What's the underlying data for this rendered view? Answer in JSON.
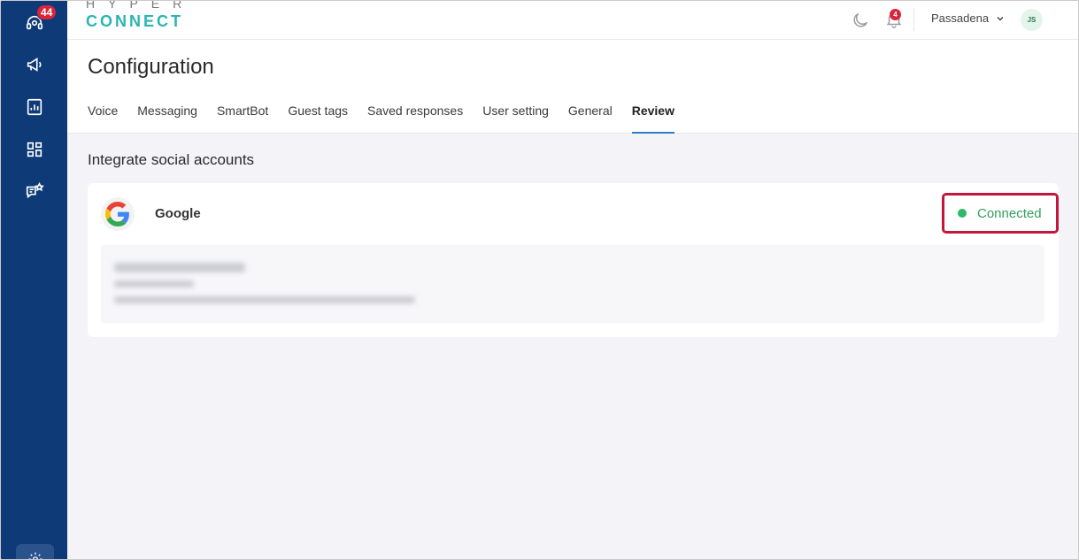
{
  "sidebar": {
    "badge_count": "44",
    "icons": [
      "headset-icon",
      "megaphone-icon",
      "report-icon",
      "apps-grid-icon",
      "chat-star-icon",
      "settings-icon"
    ]
  },
  "header": {
    "logo_top": "HYPER",
    "logo_bottom": "CONNECT",
    "notifications_count": "4",
    "location": "Passadena",
    "avatar_initials": "JS"
  },
  "page": {
    "title": "Configuration",
    "tabs": [
      "Voice",
      "Messaging",
      "SmartBot",
      "Guest tags",
      "Saved responses",
      "User setting",
      "General",
      "Review"
    ],
    "active_tab": "Review"
  },
  "integrations": {
    "section_title": "Integrate social accounts",
    "provider": "Google",
    "status": "Connected",
    "colors": {
      "status": "#2fb866",
      "highlight": "#c4163c",
      "sidebar": "#0e3a78",
      "accent": "#2f7cc9"
    }
  }
}
